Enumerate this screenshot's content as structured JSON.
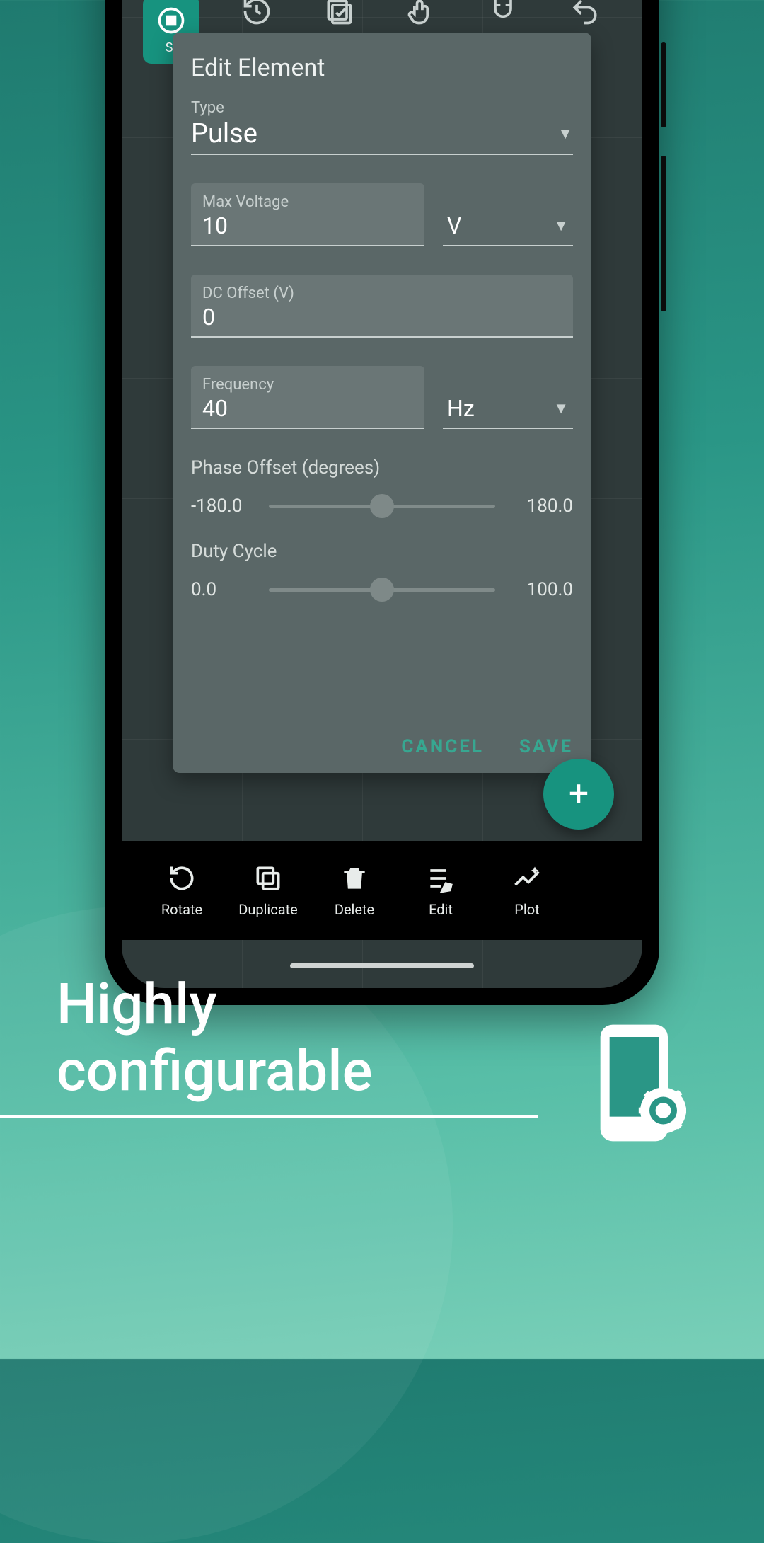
{
  "topToolbar": {
    "activeLabel": "St"
  },
  "dialog": {
    "title": "Edit Element",
    "type_label": "Type",
    "type_value": "Pulse",
    "maxv_label": "Max Voltage",
    "maxv_value": "10",
    "maxv_unit": "V",
    "dc_label": "DC Offset (V)",
    "dc_value": "0",
    "freq_label": "Frequency",
    "freq_value": "40",
    "freq_unit": "Hz",
    "phase_label": "Phase Offset (degrees)",
    "phase_min": "-180.0",
    "phase_max": "180.0",
    "phase_pct": 50,
    "duty_label": "Duty Cycle",
    "duty_min": "0.0",
    "duty_max": "100.0",
    "duty_pct": 50,
    "cancel": "CANCEL",
    "save": "SAVE"
  },
  "fab": {
    "glyph": "+"
  },
  "bottomNav": {
    "rotate": "Rotate",
    "duplicate": "Duplicate",
    "delete": "Delete",
    "edit": "Edit",
    "plot": "Plot"
  },
  "promo": {
    "tagline": "Highly configurable"
  }
}
